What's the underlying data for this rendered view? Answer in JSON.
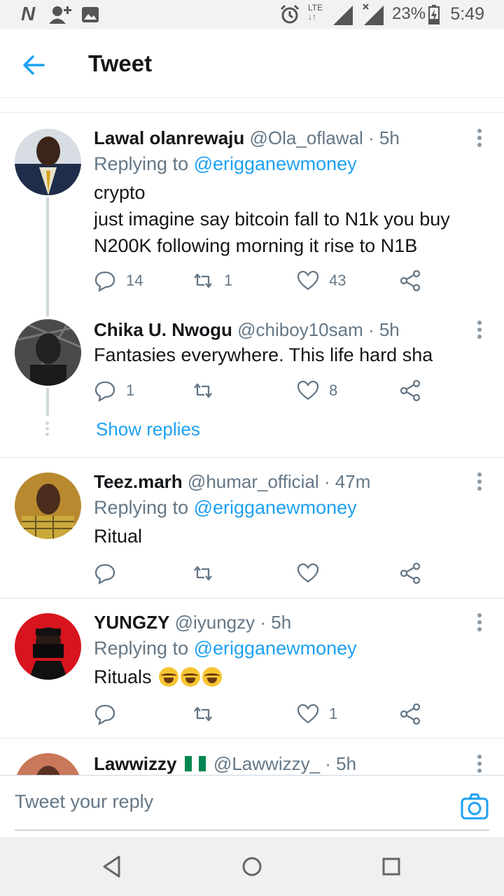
{
  "status_bar": {
    "carrier_icon": "N",
    "icons": [
      "add-user-icon",
      "image-icon",
      "alarm-icon",
      "lte-icon",
      "signal-icon",
      "signal-x-icon",
      "battery-charging-icon"
    ],
    "lte_label": "LTE",
    "battery": "23%",
    "time": "5:49"
  },
  "header": {
    "title": "Tweet",
    "back_icon": "arrow-left-icon"
  },
  "tweets": [
    {
      "name": "Lawal olanrewaju",
      "handle": "@Ola_oflawal · 5h",
      "replying_prefix": "Replying to ",
      "replying_to": "@erigganewmoney",
      "lines": [
        "crypto",
        "just imagine say bitcoin fall to N1k you buy",
        "N200K following morning it rise to N1B"
      ],
      "replies": "14",
      "retweets": "1",
      "likes": "43"
    },
    {
      "name": "Chika U. Nwogu",
      "handle": "@chiboy10sam · 5h",
      "lines": [
        "Fantasies everywhere. This life hard sha"
      ],
      "replies": "1",
      "retweets": "",
      "likes": "8",
      "show_replies": "Show replies"
    },
    {
      "name": "Teez.marh",
      "handle": "@humar_official · 47m",
      "replying_prefix": "Replying to ",
      "replying_to": "@erigganewmoney",
      "lines": [
        "Ritual"
      ],
      "replies": "",
      "retweets": "",
      "likes": ""
    },
    {
      "name": "YUNGZY",
      "handle": "@iyungzy · 5h",
      "replying_prefix": "Replying to ",
      "replying_to": "@erigganewmoney",
      "lines": [
        "Rituals"
      ],
      "emoji": "😂😂😂",
      "replies": "",
      "retweets": "",
      "likes": "1"
    },
    {
      "name": "Lawwizzy",
      "handle": "@Lawwizzy_ · 5h",
      "flag": "Nigeria"
    }
  ],
  "composer": {
    "placeholder": "Tweet your reply",
    "camera_icon": "camera-icon"
  },
  "colors": {
    "accent": "#1da1f2",
    "secondary_text": "#657786",
    "divider": "#e1e8ed"
  }
}
